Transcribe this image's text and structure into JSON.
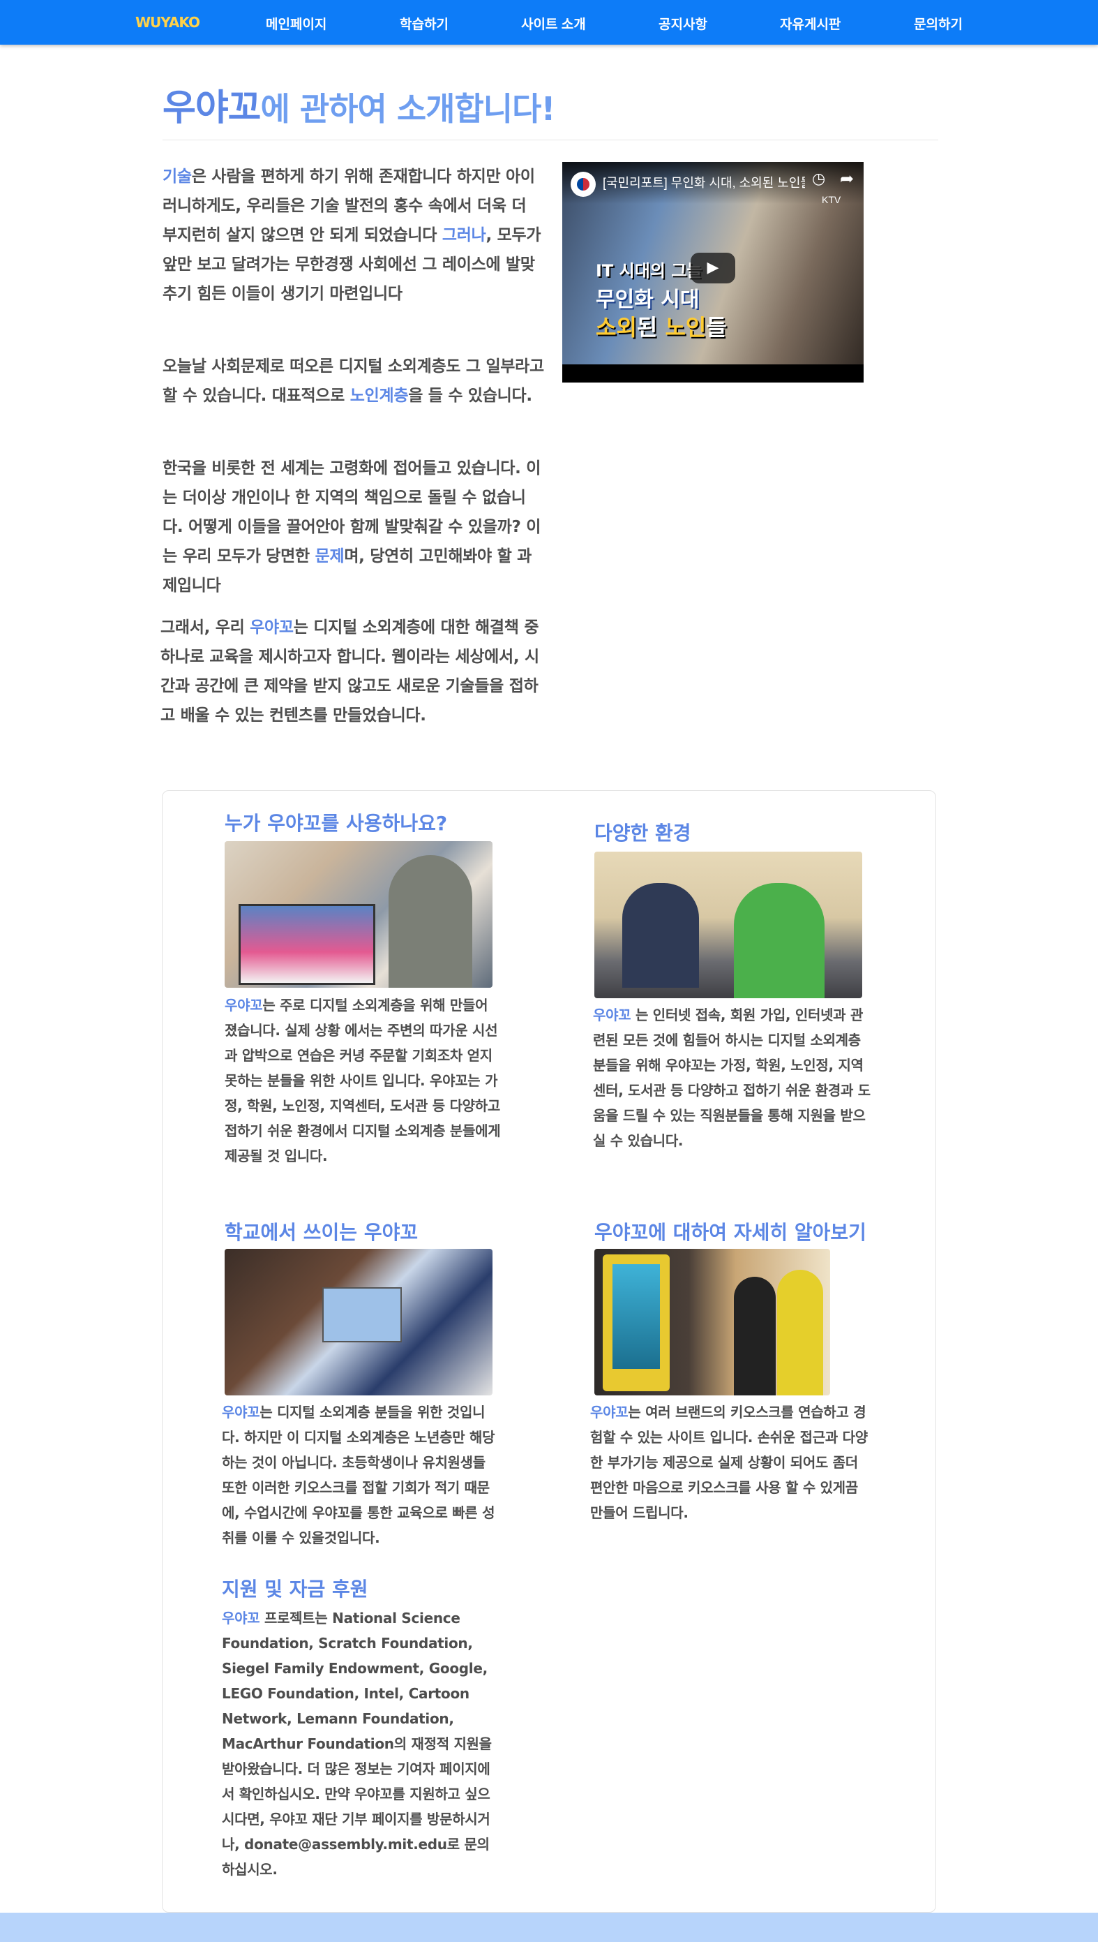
{
  "nav": {
    "logo": "WUYAKO",
    "items": [
      "메인페이지",
      "학습하기",
      "사이트 소개",
      "공지사항",
      "자유게시판",
      "문의하기"
    ]
  },
  "title": {
    "highlight": "우야꼬",
    "rest": "에 관하여 소개합니다!"
  },
  "intro": {
    "p1": {
      "a": "기술",
      "b": "은 사람을 편하게 하기 위해 존재합니다 하지만 아이러니하게도, 우리들은 기술 발전의 홍수 속에서 더욱 더 부지런히 살지 않으면 안 되게 되었습니다 ",
      "c": "그러나",
      "d": ", 모두가 앞만 보고 달려가는 무한경쟁 사회에선 그 레이스에 발맞추기 힘든 이들이 생기기 마련입니다"
    },
    "p2": {
      "a": "오늘날 사회문제로 떠오른 디지털 소외계층도 그 일부라고 할 수 있습니다. 대표적으로 ",
      "b": "노인계층",
      "c": "을 들 수 있습니다."
    },
    "p3": {
      "a": "한국을 비롯한 전 세계는 고령화에 접어들고 있습니다. 이는 더이상 개인이나 한 지역의 책임으로 돌릴 수 없습니다. 어떻게 이들을 끌어안아 함께 발맞춰갈 수 있을까? 이는 우리 모두가 당면한 ",
      "b": "문제",
      "c": "며, 당연히 고민해봐야 할 과제입니다"
    },
    "p4": {
      "a": "그래서, 우리 ",
      "b": "우야꼬",
      "c": "는 디지털 소외계층에 대한 해결책 중 하나로 교육을 제시하고자 합니다. 웹이라는 세상에서, 시간과 공간에 큰 제약을 받지 않고도 새로운 기술들을 접하고 배울 수 있는 컨텐츠를 만들었습니다."
    }
  },
  "video": {
    "title": "[국민리포트] 무인화 시대, 소외된 노인들",
    "channel": "KTV",
    "caption1": "IT 시대의 그늘",
    "caption2": "무인화 시대",
    "caption3_a": "소외",
    "caption3_b": "된 ",
    "caption3_c": "노인",
    "caption3_d": "들",
    "clock_icon": "clock-icon",
    "share_icon": "share-icon"
  },
  "sections": {
    "who": {
      "heading": "누가 우야꼬를 사용하나요?",
      "brand": "우야꼬",
      "text": "는 주로 디지털 소외계층을 위해 만들어 졌습니다. 실제 상황 에서는 주변의 따가운 시선과 압박으로 연습은 커녕 주문할 기회조차 얻지 못하는 분들을 위한 사이트 입니다. 우야꼬는 가정, 학원, 노인정, 지역센터, 도서관 등 다양하고 접하기 쉬운 환경에서 디지털 소외계층 분들에게 제공될 것 입니다."
    },
    "env": {
      "heading": "다양한 환경",
      "brand": "우야꼬",
      "text": " 는 인터넷 접속, 회원 가입, 인터넷과 관련된 모든 것에 힘들어 하시는 디지털 소외계층 분들을 위해 우야꼬는 가정, 학원, 노인정, 지역센터, 도서관 등 다양하고 접하기 쉬운 환경과 도움을 드릴 수 있는 직원분들을 통해 지원을 받으실 수 있습니다."
    },
    "school": {
      "heading": "학교에서 쓰이는 우야꼬",
      "brand": "우야꼬",
      "text": "는 디지털 소외계층 분들을 위한 것입니다. 하지만 이 디지털 소외계층은 노년층만 해당하는 것이 아닙니다. 초등학생이나 유치원생들 또한 이러한 키오스크를 접할 기회가 적기 때문에, 수업시간에 우야꼬를 통한 교육으로 빠른 성취를 이룰 수 있을것입니다."
    },
    "more": {
      "heading": "우야꼬에 대하여 자세히 알아보기",
      "brand": "우야꼬",
      "text": "는 여러 브랜드의 키오스크를 연습하고 경험할 수 있는 사이트 입니다. 손쉬운 접근과 다양한 부가기능 제공으로 실제 상황이 되어도 좀더 편안한 마음으로 키오스크를 사용 할 수 있게끔 만들어 드립니다."
    },
    "support": {
      "heading": "지원 및 자금 후원",
      "brand": "우야꼬",
      "text": " 프로젝트는 National Science Foundation, Scratch Foundation, Siegel Family Endowment, Google, LEGO Foundation, Intel, Cartoon Network, Lemann Foundation, MacArthur Foundation의 재정적 지원을 받아왔습니다. 더 많은 정보는 기여자 페이지에서 확인하십시오. 만약 우야꼬를 지원하고 싶으시다면, 우야꼬 재단 기부 페이지를 방문하시거나, donate@assembly.mit.edu로 문의하십시오."
    }
  },
  "colors": {
    "nav": "#0d7cf8",
    "accent": "#5b86e5",
    "logo": "#ffd24a",
    "footer": "#b7d4fb"
  }
}
